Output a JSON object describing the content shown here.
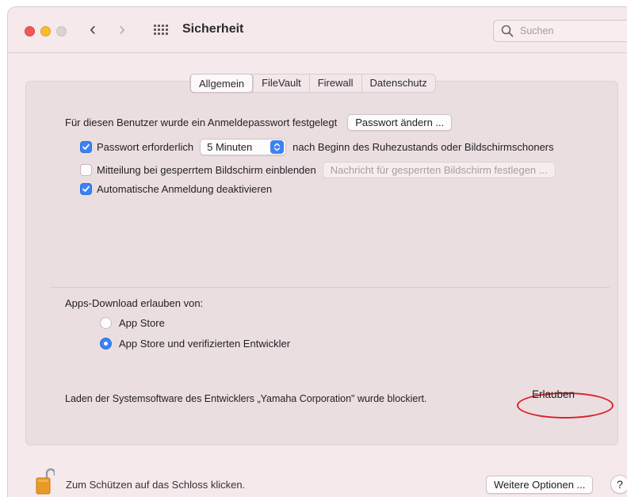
{
  "window": {
    "title": "Sicherheit"
  },
  "search": {
    "placeholder": "Suchen"
  },
  "tabs": [
    {
      "label": "Allgemein",
      "active": true
    },
    {
      "label": "FileVault",
      "active": false
    },
    {
      "label": "Firewall",
      "active": false
    },
    {
      "label": "Datenschutz",
      "active": false
    }
  ],
  "general": {
    "password_text": "Für diesen Benutzer wurde ein Anmeldepasswort festgelegt",
    "change_password_button": "Passwort ändern ...",
    "require_password_label": "Passwort erforderlich",
    "require_password_checked": true,
    "require_password_delay": "5 Minuten",
    "require_password_suffix": "nach Beginn des Ruhezustands oder Bildschirmschoners",
    "lock_message_label": "Mitteilung bei gesperrtem Bildschirm einblenden",
    "lock_message_checked": false,
    "lock_message_button": "Nachricht für gesperrten Bildschirm festlegen ...",
    "disable_autologin_label": "Automatische Anmeldung deaktivieren",
    "disable_autologin_checked": true
  },
  "downloads": {
    "heading": "Apps-Download erlauben von:",
    "options": [
      {
        "label": "App Store",
        "selected": false
      },
      {
        "label": "App Store und verifizierten Entwickler",
        "selected": true
      }
    ],
    "blocked_message": "Laden der Systemsoftware des Entwicklers „Yamaha Corporation\" wurde blockiert.",
    "allow_button": "Erlauben",
    "highlight_color": "#d8202a"
  },
  "footer": {
    "lock_text": "Zum Schützen auf das Schloss klicken.",
    "more_options_button": "Weitere Optionen ...",
    "help_button": "?"
  },
  "colors": {
    "accent": "#3b82f6",
    "window_bg": "#f6e9ec",
    "panel_bg": "#ebdee1"
  }
}
